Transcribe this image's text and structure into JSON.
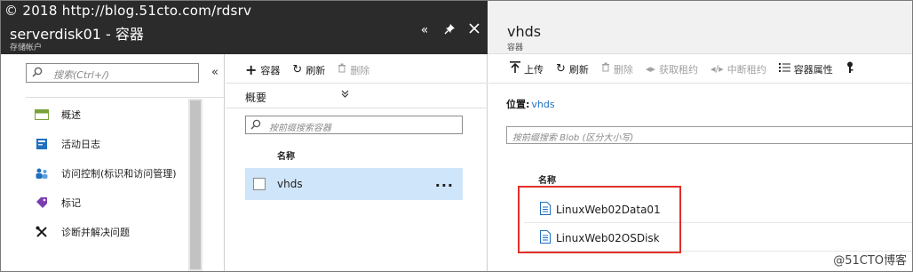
{
  "watermark": {
    "top": "© 2018 http://blog.51cto.com/rdsrv",
    "bottom_right": "@51CTO博客"
  },
  "left_header": {
    "title": "serverdisk01 - 容器",
    "subtitle": "存储帐户"
  },
  "right_header": {
    "title": "vhds",
    "subtitle": "容器"
  },
  "menu": {
    "search_placeholder": "搜索(Ctrl+/)",
    "items": [
      {
        "label": "概述",
        "icon": "overview-icon",
        "color": "#7aa23a"
      },
      {
        "label": "活动日志",
        "icon": "activity-log-icon",
        "color": "#1f6fc0"
      },
      {
        "label": "访问控制(标识和访问管理)",
        "icon": "access-control-icon",
        "color": "#1f6fc0"
      },
      {
        "label": "标记",
        "icon": "tag-icon",
        "color": "#7a3db0"
      },
      {
        "label": "诊断并解决问题",
        "icon": "tools-icon",
        "color": "#1e1e1e"
      }
    ]
  },
  "containers": {
    "toolbar": {
      "add": "容器",
      "refresh": "刷新",
      "delete": "删除"
    },
    "overview_label": "概要",
    "search_placeholder": "按前缀搜索容器",
    "column_name": "名称",
    "rows": [
      {
        "name": "vhds",
        "more": "..."
      }
    ]
  },
  "blobs": {
    "toolbar": {
      "upload": "上传",
      "refresh": "刷新",
      "delete": "删除",
      "acquire_lease": "获取租约",
      "break_lease": "中断租约",
      "properties": "容器属性"
    },
    "location_label": "位置:",
    "location_value": "vhds",
    "search_placeholder": "按前缀搜索 Blob (区分大小写)",
    "column_name": "名称",
    "rows": [
      {
        "name": "LinuxWeb02Data01"
      },
      {
        "name": "LinuxWeb02OSDisk"
      }
    ]
  },
  "colors": {
    "highlight": "#e0302a",
    "selected_row": "#cfe5fa",
    "link": "#1f6fc0"
  }
}
